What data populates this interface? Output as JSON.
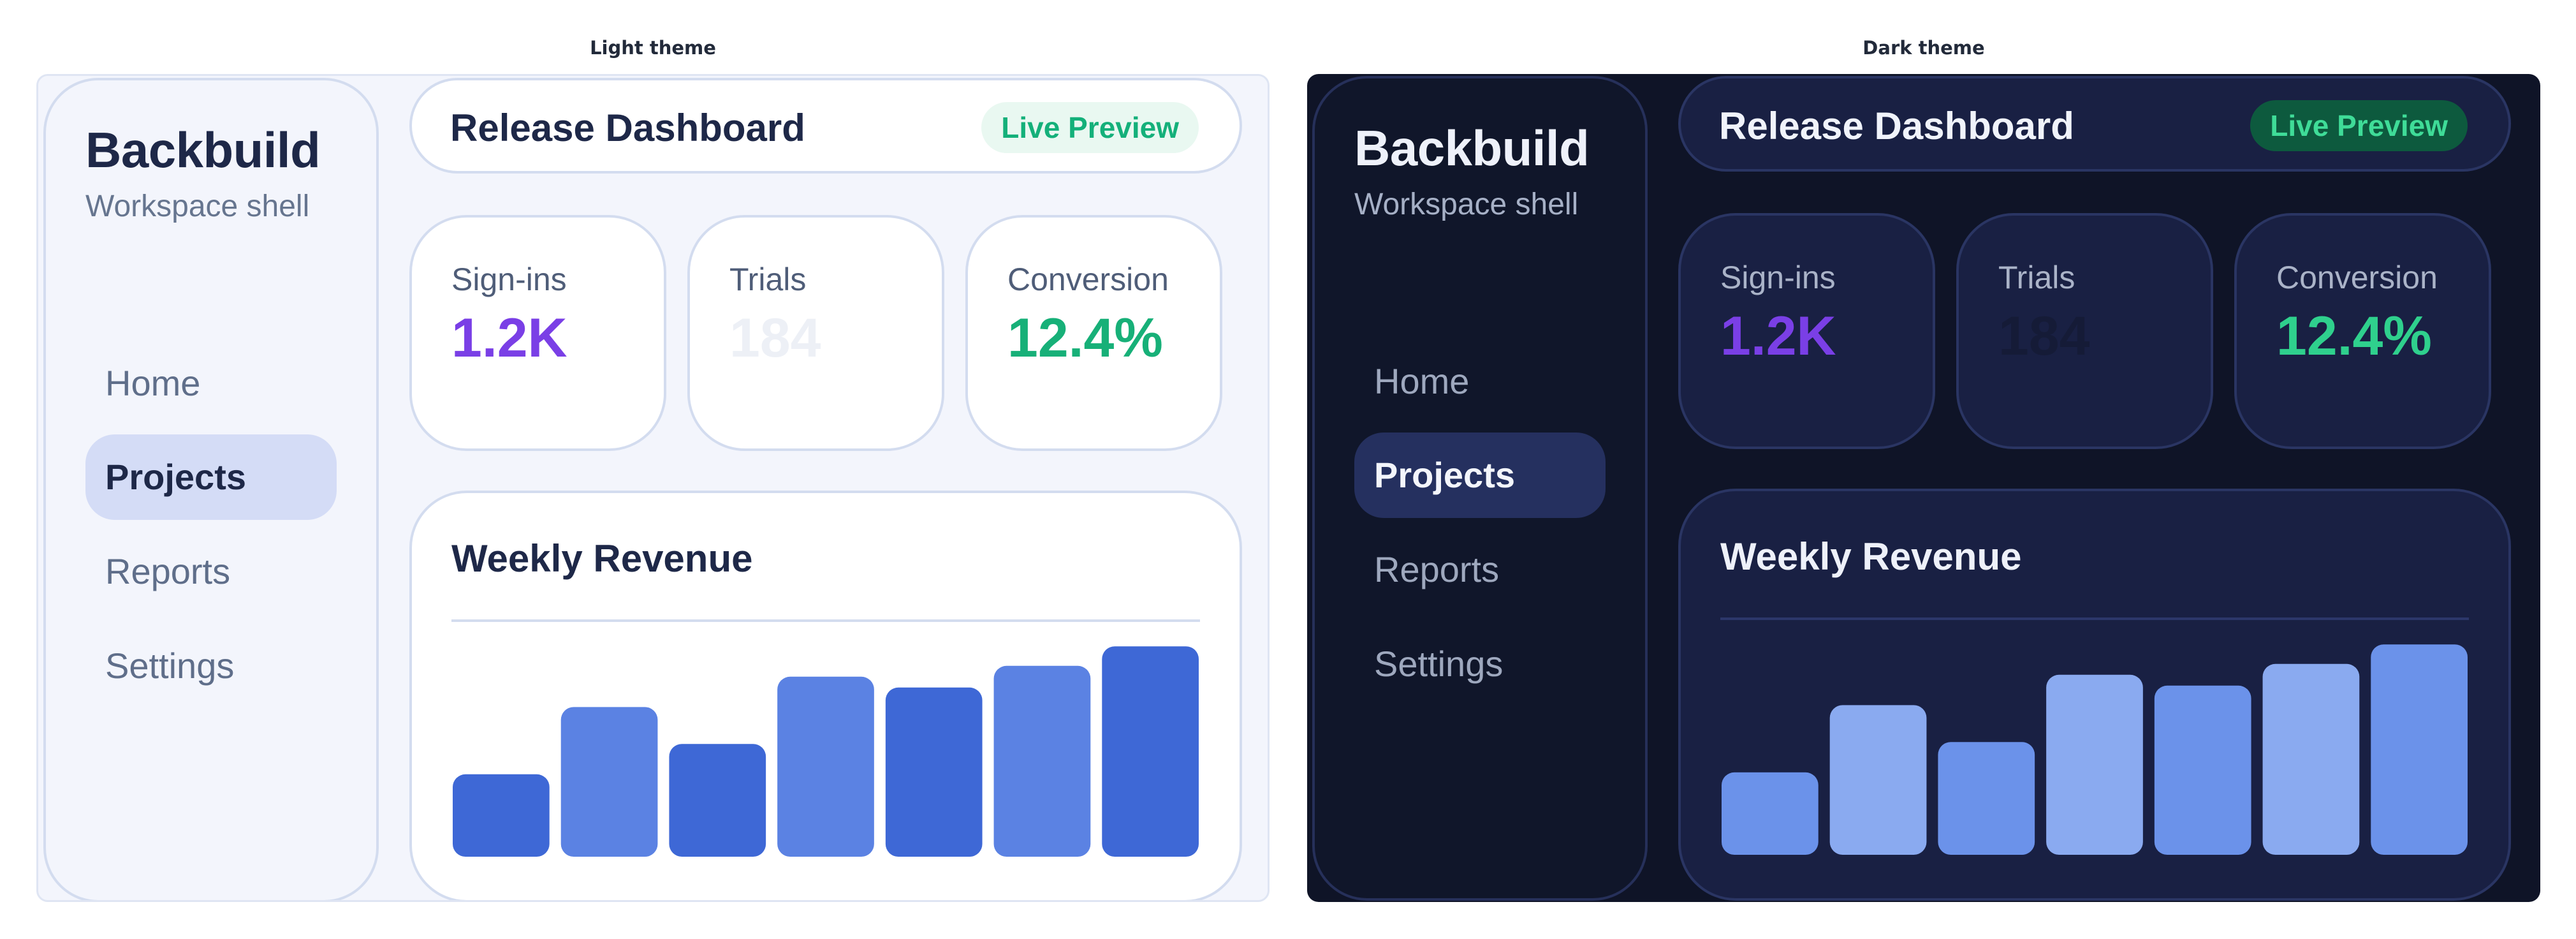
{
  "theme_titles": {
    "light": "Light theme",
    "dark": "Dark theme"
  },
  "sidebar": {
    "brand": "Backbuild",
    "subtitle": "Workspace shell",
    "items": [
      {
        "label": "Home",
        "active": false
      },
      {
        "label": "Projects",
        "active": true
      },
      {
        "label": "Reports",
        "active": false
      },
      {
        "label": "Settings",
        "active": false
      }
    ]
  },
  "header": {
    "title": "Release Dashboard",
    "badge": "Live Preview"
  },
  "stats": [
    {
      "label": "Sign-ins",
      "value": "1.2K"
    },
    {
      "label": "Trials",
      "value": "184"
    },
    {
      "label": "Conversion",
      "value": "12.4%"
    }
  ],
  "colors": {
    "accent_purple": "#7a3fe6",
    "accent_green": "#17b078",
    "light_bar_dark": "#3e68d6",
    "light_bar_light": "#5b82e3",
    "dark_bar_dark": "#6b92ea",
    "dark_bar_light": "#8aaaf0"
  },
  "chart_data": {
    "type": "bar",
    "title": "Weekly Revenue",
    "categories": [
      "",
      "",
      "",
      "",
      "",
      "",
      ""
    ],
    "values": [
      38,
      69,
      52,
      83,
      78,
      88,
      97
    ],
    "ylim": [
      0,
      100
    ],
    "grid": false,
    "legend": "none"
  }
}
